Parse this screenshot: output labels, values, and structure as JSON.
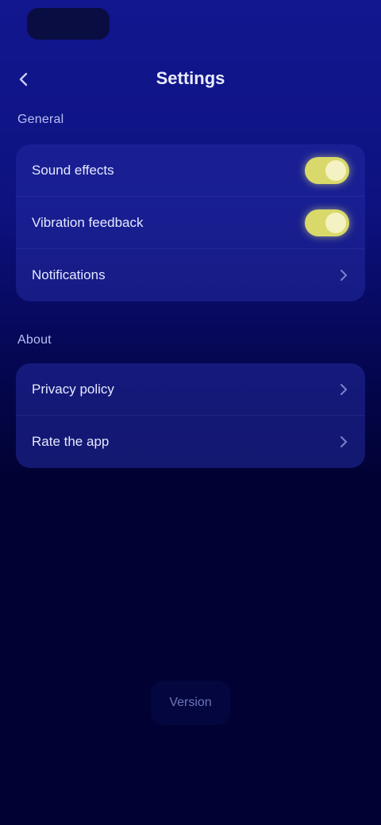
{
  "status_bar": {
    "pill": ""
  },
  "header": {
    "back_icon": "chevron-left-icon",
    "title": "Settings"
  },
  "sections": [
    {
      "label": "General",
      "rows": [
        {
          "label": "Sound effects",
          "control": "toggle",
          "on": true
        },
        {
          "label": "Vibration feedback",
          "control": "toggle",
          "on": true
        },
        {
          "label": "Notifications",
          "control": "chevron"
        }
      ]
    },
    {
      "label": "About",
      "rows": [
        {
          "label": "Privacy policy",
          "control": "chevron"
        },
        {
          "label": "Rate the app",
          "control": "chevron"
        }
      ]
    }
  ],
  "footer": {
    "button_label": "Version"
  },
  "colors": {
    "accent_toggle": "#d9d86a",
    "background_top": "#12178f",
    "background_bottom": "#010233"
  }
}
